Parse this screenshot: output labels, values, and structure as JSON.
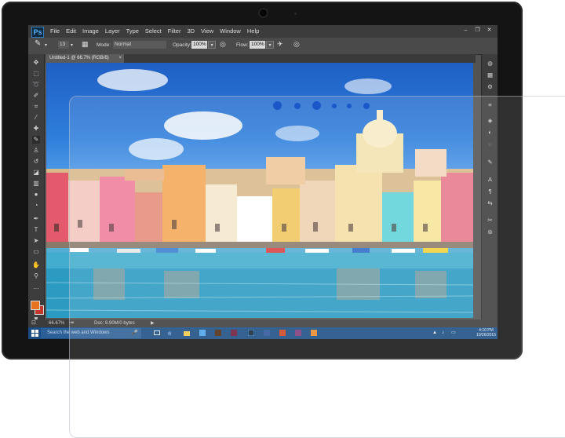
{
  "menu": {
    "logo": "Ps",
    "items": [
      "File",
      "Edit",
      "Image",
      "Layer",
      "Type",
      "Select",
      "Filter",
      "3D",
      "View",
      "Window",
      "Help"
    ]
  },
  "options": {
    "brush_size": "13",
    "mode_label": "Mode:",
    "mode_value": "Normal",
    "opacity_label": "Opacity:",
    "opacity_value": "100%",
    "flow_label": "Flow:",
    "flow_value": "100%"
  },
  "document": {
    "tab_title": "Untitled-1 @ 66.7% (RGB/8)",
    "close": "×"
  },
  "status": {
    "zoom": "66.67%",
    "doc_info": "Doc: 8.90M/0 bytes"
  },
  "taskbar": {
    "search_placeholder": "Search the web and Windows",
    "time": "4:10 PM",
    "date": "10/26/2015"
  },
  "icons": {
    "tools": [
      "move-icon",
      "marquee-icon",
      "lasso-icon",
      "quick-select-icon",
      "crop-icon",
      "eyedropper-icon",
      "healing-icon",
      "brush-icon",
      "stamp-icon",
      "history-brush-icon",
      "eraser-icon",
      "gradient-icon",
      "blur-icon",
      "dodge-icon",
      "pen-icon",
      "type-icon",
      "path-select-icon",
      "shape-icon",
      "hand-icon",
      "zoom-icon"
    ],
    "panels": [
      "history-icon",
      "swatches-icon",
      "adjustments-icon",
      "layers-icon",
      "channels-icon",
      "paths-icon",
      "character-icon",
      "paragraph-icon",
      "brush-presets-icon",
      "properties-icon",
      "actions-icon"
    ]
  },
  "colors": {
    "foreground": "#e8731e",
    "background": "#c0392b",
    "taskbar": "#1b4d82",
    "dots": "#1a57c9"
  }
}
